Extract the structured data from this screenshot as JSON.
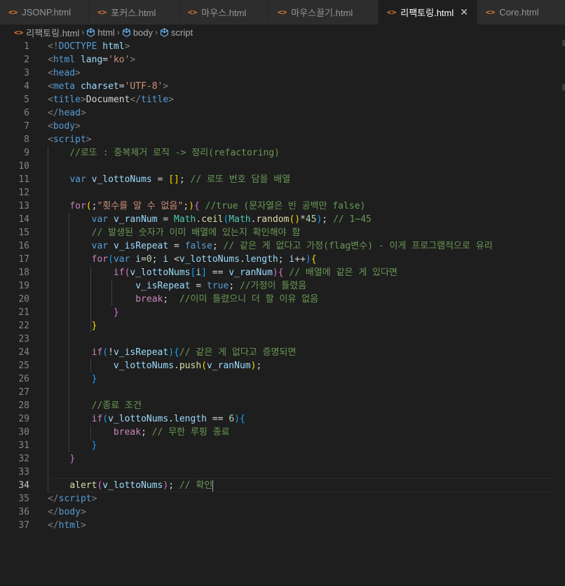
{
  "tabs": [
    {
      "label": "JSONP.html",
      "active": false
    },
    {
      "label": "포커스.html",
      "active": false
    },
    {
      "label": "마우스.html",
      "active": false
    },
    {
      "label": "마우스끌기.html",
      "active": false
    },
    {
      "label": "리팩토링.html",
      "active": true
    },
    {
      "label": "Core.html",
      "active": false
    }
  ],
  "tab_icon": "<>",
  "breadcrumb": {
    "file": "리팩토링.html",
    "items": [
      "html",
      "body",
      "script"
    ]
  },
  "editor": {
    "current_line": 34,
    "lines": [
      [
        [
          "t-tag",
          "<!"
        ],
        [
          "t-tn",
          "DOCTYPE"
        ],
        [
          "t-txt",
          " "
        ],
        [
          "t-attr",
          "html"
        ],
        [
          "t-tag",
          ">"
        ]
      ],
      [
        [
          "t-tag",
          "<"
        ],
        [
          "t-tn",
          "html"
        ],
        [
          "t-txt",
          " "
        ],
        [
          "t-attr",
          "lang"
        ],
        [
          "t-txt",
          "="
        ],
        [
          "t-str",
          "'ko'"
        ],
        [
          "t-tag",
          ">"
        ]
      ],
      [
        [
          "t-tag",
          "<"
        ],
        [
          "t-tn",
          "head"
        ],
        [
          "t-tag",
          ">"
        ]
      ],
      [
        [
          "t-tag",
          "<"
        ],
        [
          "t-tn",
          "meta"
        ],
        [
          "t-txt",
          " "
        ],
        [
          "t-attr",
          "charset"
        ],
        [
          "t-txt",
          "="
        ],
        [
          "t-str",
          "'UTF-8'"
        ],
        [
          "t-tag",
          ">"
        ]
      ],
      [
        [
          "t-tag",
          "<"
        ],
        [
          "t-tn",
          "title"
        ],
        [
          "t-tag",
          ">"
        ],
        [
          "t-txt",
          "Document"
        ],
        [
          "t-tag",
          "</"
        ],
        [
          "t-tn",
          "title"
        ],
        [
          "t-tag",
          ">"
        ]
      ],
      [
        [
          "t-tag",
          "</"
        ],
        [
          "t-tn",
          "head"
        ],
        [
          "t-tag",
          ">"
        ]
      ],
      [
        [
          "t-tag",
          "<"
        ],
        [
          "t-tn",
          "body"
        ],
        [
          "t-tag",
          ">"
        ]
      ],
      [
        [
          "t-tag",
          "<"
        ],
        [
          "t-tn",
          "script"
        ],
        [
          "t-tag",
          ">"
        ]
      ],
      [
        [
          "t-txt",
          "    "
        ],
        [
          "t-cm",
          "//로또 : 중복제거 로직 -> 정리(refactoring)"
        ]
      ],
      [],
      [
        [
          "t-txt",
          "    "
        ],
        [
          "t-kw",
          "var"
        ],
        [
          "t-txt",
          " "
        ],
        [
          "t-var",
          "v_lottoNums"
        ],
        [
          "t-txt",
          " = "
        ],
        [
          "t-b1",
          "[]"
        ],
        [
          "t-txt",
          "; "
        ],
        [
          "t-cm",
          "// 로또 번호 담을 배열"
        ]
      ],
      [],
      [
        [
          "t-txt",
          "    "
        ],
        [
          "t-ctrl",
          "for"
        ],
        [
          "t-b1",
          "("
        ],
        [
          "t-txt",
          ";"
        ],
        [
          "t-str",
          "\"횟수를 알 수 없음\""
        ],
        [
          "t-txt",
          ";"
        ],
        [
          "t-b1",
          ")"
        ],
        [
          "t-b2",
          "{"
        ],
        [
          "t-txt",
          " "
        ],
        [
          "t-cm",
          "//true (문자열은 빈 공백만 false)"
        ]
      ],
      [
        [
          "t-txt",
          "        "
        ],
        [
          "t-kw",
          "var"
        ],
        [
          "t-txt",
          " "
        ],
        [
          "t-var",
          "v_ranNum"
        ],
        [
          "t-txt",
          " = "
        ],
        [
          "t-cls",
          "Math"
        ],
        [
          "t-txt",
          "."
        ],
        [
          "t-fn",
          "ceil"
        ],
        [
          "t-b3",
          "("
        ],
        [
          "t-cls",
          "Math"
        ],
        [
          "t-txt",
          "."
        ],
        [
          "t-fn",
          "random"
        ],
        [
          "t-b1",
          "()"
        ],
        [
          "t-txt",
          "*"
        ],
        [
          "t-num",
          "45"
        ],
        [
          "t-b3",
          ")"
        ],
        [
          "t-txt",
          "; "
        ],
        [
          "t-cm",
          "// 1~45"
        ]
      ],
      [
        [
          "t-txt",
          "        "
        ],
        [
          "t-cm",
          "// 발생된 숫자가 이미 배열에 있는지 확인해야 함"
        ]
      ],
      [
        [
          "t-txt",
          "        "
        ],
        [
          "t-kw",
          "var"
        ],
        [
          "t-txt",
          " "
        ],
        [
          "t-var",
          "v_isRepeat"
        ],
        [
          "t-txt",
          " = "
        ],
        [
          "t-kw",
          "false"
        ],
        [
          "t-txt",
          "; "
        ],
        [
          "t-cm",
          "// 같은 게 없다고 가정(flag변수) - 이게 프로그램적으로 유리"
        ]
      ],
      [
        [
          "t-txt",
          "        "
        ],
        [
          "t-ctrl",
          "for"
        ],
        [
          "t-b3",
          "("
        ],
        [
          "t-kw",
          "var"
        ],
        [
          "t-txt",
          " "
        ],
        [
          "t-var",
          "i"
        ],
        [
          "t-txt",
          "="
        ],
        [
          "t-num",
          "0"
        ],
        [
          "t-txt",
          "; "
        ],
        [
          "t-var",
          "i"
        ],
        [
          "t-txt",
          " <"
        ],
        [
          "t-var",
          "v_lottoNums"
        ],
        [
          "t-txt",
          "."
        ],
        [
          "t-var",
          "length"
        ],
        [
          "t-txt",
          "; "
        ],
        [
          "t-var",
          "i"
        ],
        [
          "t-txt",
          "++"
        ],
        [
          "t-b3",
          ")"
        ],
        [
          "t-b1",
          "{"
        ]
      ],
      [
        [
          "t-txt",
          "            "
        ],
        [
          "t-ctrl",
          "if"
        ],
        [
          "t-b2",
          "("
        ],
        [
          "t-var",
          "v_lottoNums"
        ],
        [
          "t-b3",
          "["
        ],
        [
          "t-var",
          "i"
        ],
        [
          "t-b3",
          "]"
        ],
        [
          "t-txt",
          " == "
        ],
        [
          "t-var",
          "v_ranNum"
        ],
        [
          "t-b2",
          ")"
        ],
        [
          "t-b2",
          "{"
        ],
        [
          "t-txt",
          " "
        ],
        [
          "t-cm",
          "// 배열에 같은 게 있다면"
        ]
      ],
      [
        [
          "t-txt",
          "                "
        ],
        [
          "t-var",
          "v_isRepeat"
        ],
        [
          "t-txt",
          " = "
        ],
        [
          "t-kw",
          "true"
        ],
        [
          "t-txt",
          "; "
        ],
        [
          "t-cm",
          "//가정이 틀렸음"
        ]
      ],
      [
        [
          "t-txt",
          "                "
        ],
        [
          "t-ctrl",
          "break"
        ],
        [
          "t-txt",
          ";  "
        ],
        [
          "t-cm",
          "//이미 틀렸으니 더 할 이유 없음"
        ]
      ],
      [
        [
          "t-txt",
          "            "
        ],
        [
          "t-b2",
          "}"
        ]
      ],
      [
        [
          "t-txt",
          "        "
        ],
        [
          "t-b1",
          "}"
        ]
      ],
      [],
      [
        [
          "t-txt",
          "        "
        ],
        [
          "t-ctrl",
          "if"
        ],
        [
          "t-b3",
          "("
        ],
        [
          "t-txt",
          "!"
        ],
        [
          "t-var",
          "v_isRepeat"
        ],
        [
          "t-b3",
          ")"
        ],
        [
          "t-b3",
          "{"
        ],
        [
          "t-cm",
          "// 같은 게 없다고 증명되면"
        ]
      ],
      [
        [
          "t-txt",
          "            "
        ],
        [
          "t-var",
          "v_lottoNums"
        ],
        [
          "t-txt",
          "."
        ],
        [
          "t-fn",
          "push"
        ],
        [
          "t-b1",
          "("
        ],
        [
          "t-var",
          "v_ranNum"
        ],
        [
          "t-b1",
          ")"
        ],
        [
          "t-txt",
          ";"
        ]
      ],
      [
        [
          "t-txt",
          "        "
        ],
        [
          "t-b3",
          "}"
        ]
      ],
      [],
      [
        [
          "t-txt",
          "        "
        ],
        [
          "t-cm",
          "//종료 조건"
        ]
      ],
      [
        [
          "t-txt",
          "        "
        ],
        [
          "t-ctrl",
          "if"
        ],
        [
          "t-b3",
          "("
        ],
        [
          "t-var",
          "v_lottoNums"
        ],
        [
          "t-txt",
          "."
        ],
        [
          "t-var",
          "length"
        ],
        [
          "t-txt",
          " == "
        ],
        [
          "t-num",
          "6"
        ],
        [
          "t-b3",
          ")"
        ],
        [
          "t-b3",
          "{"
        ]
      ],
      [
        [
          "t-txt",
          "            "
        ],
        [
          "t-ctrl",
          "break"
        ],
        [
          "t-txt",
          "; "
        ],
        [
          "t-cm",
          "// 무한 루핑 종료"
        ]
      ],
      [
        [
          "t-txt",
          "        "
        ],
        [
          "t-b3",
          "}"
        ]
      ],
      [
        [
          "t-txt",
          "    "
        ],
        [
          "t-b2",
          "}"
        ]
      ],
      [],
      [
        [
          "t-txt",
          "    "
        ],
        [
          "t-fn",
          "alert"
        ],
        [
          "t-b2",
          "("
        ],
        [
          "t-var",
          "v_lottoNums"
        ],
        [
          "t-b2",
          ")"
        ],
        [
          "t-txt",
          "; "
        ],
        [
          "t-cm",
          "// 확인"
        ]
      ],
      [
        [
          "t-tag",
          "</"
        ],
        [
          "t-tn",
          "script"
        ],
        [
          "t-tag",
          ">"
        ]
      ],
      [
        [
          "t-tag",
          "</"
        ],
        [
          "t-tn",
          "body"
        ],
        [
          "t-tag",
          ">"
        ]
      ],
      [
        [
          "t-tag",
          "</"
        ],
        [
          "t-tn",
          "html"
        ],
        [
          "t-tag",
          ">"
        ]
      ]
    ]
  }
}
